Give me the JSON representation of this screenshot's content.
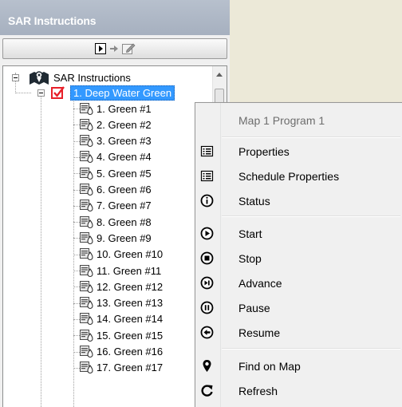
{
  "panel": {
    "title": "SAR Instructions"
  },
  "tree": {
    "root_label": "SAR Instructions",
    "program_label": "1. Deep Water Green",
    "greens": [
      "1. Green #1",
      "2. Green #2",
      "3. Green #3",
      "4. Green #4",
      "5. Green #5",
      "6. Green #6",
      "7. Green #7",
      "8. Green #8",
      "9. Green #9",
      "10. Green #10",
      "11. Green #11",
      "12. Green #12",
      "13. Green #13",
      "14. Green #14",
      "15. Green #15",
      "16. Green #16",
      "17. Green #17"
    ]
  },
  "context_menu": {
    "header": "Map 1 Program 1",
    "properties": "Properties",
    "schedule_properties": "Schedule Properties",
    "status": "Status",
    "start": "Start",
    "stop": "Stop",
    "advance": "Advance",
    "pause": "Pause",
    "resume": "Resume",
    "find_on_map": "Find on Map",
    "refresh": "Refresh"
  },
  "colors": {
    "header_bg": "#aab3c2",
    "selection": "#3399ff",
    "checkbox_red": "#e8202a"
  }
}
